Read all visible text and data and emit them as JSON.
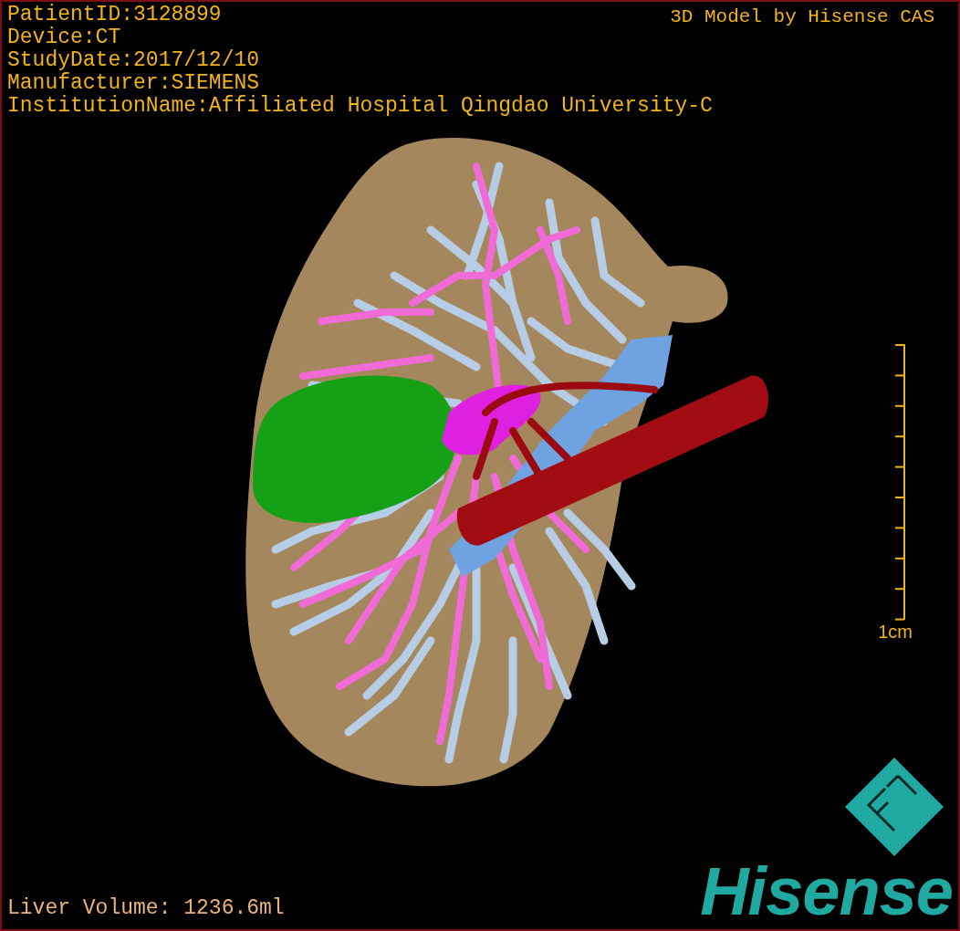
{
  "info_lines": [
    "PatientID:3128899",
    "Device:CT",
    "StudyDate:2017/12/10",
    "Manufacturer:SIEMENS",
    "InstitutionName:Affiliated Hospital Qingdao University-C"
  ],
  "credit": "3D Model by Hisense CAS",
  "scale": {
    "label": "1cm"
  },
  "liver_volume": "Liver Volume: 1236.6ml",
  "logo": {
    "wordmark": "Hisense"
  }
}
